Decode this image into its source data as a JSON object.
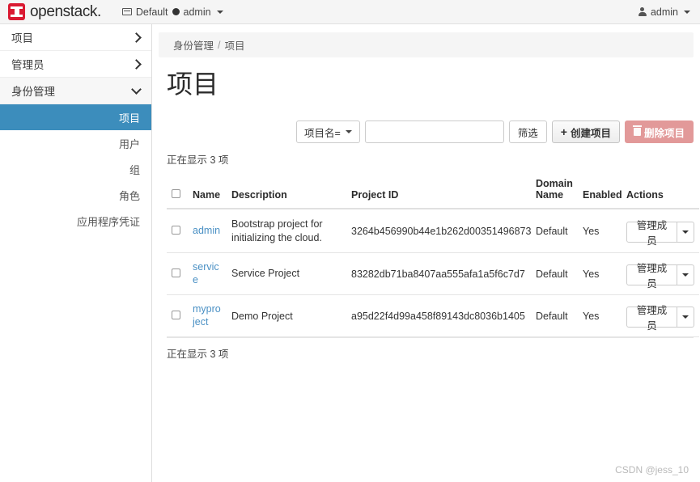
{
  "navbar": {
    "brand": "openstack.",
    "brand_logo_icon": "openstack-logo-icon",
    "domain_icon": "domain-card-icon",
    "domain_label": "Default",
    "project_dot_icon": "project-dot-icon",
    "project_label": "admin",
    "context_caret_icon": "chevron-down-icon",
    "user_icon": "user-icon",
    "user_label": "admin",
    "user_caret_icon": "chevron-down-icon"
  },
  "sidebar": {
    "groups": [
      {
        "label": "项目",
        "icon": "chevron-right-icon",
        "expanded": false
      },
      {
        "label": "管理员",
        "icon": "chevron-right-icon",
        "expanded": false
      },
      {
        "label": "身份管理",
        "icon": "chevron-down-icon",
        "expanded": true
      }
    ],
    "items": [
      {
        "label": "项目",
        "active": true
      },
      {
        "label": "用户",
        "active": false
      },
      {
        "label": "组",
        "active": false
      },
      {
        "label": "角色",
        "active": false
      },
      {
        "label": "应用程序凭证",
        "active": false
      }
    ]
  },
  "breadcrumb": {
    "parent": "身份管理",
    "separator": "/",
    "current": "项目"
  },
  "page": {
    "title": "项目"
  },
  "toolbar": {
    "filter_key_label": "项目名=",
    "filter_key_caret_icon": "chevron-down-icon",
    "search_value": "",
    "search_placeholder": "",
    "filter_button_label": "筛选",
    "create_button_label": "创建项目",
    "create_button_icon": "plus-icon",
    "delete_button_label": "删除项目",
    "delete_button_icon": "trash-icon"
  },
  "table": {
    "count_top": "正在显示 3 项",
    "count_bottom": "正在显示 3 项",
    "select_all_icon": "checkbox-icon",
    "columns": [
      "Name",
      "Description",
      "Project ID",
      "Domain Name",
      "Enabled",
      "Actions"
    ],
    "rows": [
      {
        "checkbox_icon": "checkbox-icon",
        "name": "admin",
        "description": "Bootstrap project for initializing the cloud.",
        "project_id": "3264b456990b44e1b262d00351496873",
        "domain_name": "Default",
        "enabled": "Yes",
        "action_label": "管理成员",
        "action_caret_icon": "chevron-down-icon"
      },
      {
        "checkbox_icon": "checkbox-icon",
        "name": "service",
        "description": "Service Project",
        "project_id": "83282db71ba8407aa555afa1a5f6c7d7",
        "domain_name": "Default",
        "enabled": "Yes",
        "action_label": "管理成员",
        "action_caret_icon": "chevron-down-icon"
      },
      {
        "checkbox_icon": "checkbox-icon",
        "name": "myproject",
        "description": "Demo Project",
        "project_id": "a95d22f4d99a458f89143dc8036b1405",
        "domain_name": "Default",
        "enabled": "Yes",
        "action_label": "管理成员",
        "action_caret_icon": "chevron-down-icon"
      }
    ]
  },
  "watermark": "CSDN @jess_10",
  "colors": {
    "brand_red": "#da1a32",
    "active_blue": "#3c8dbc",
    "link_blue": "#4a90c4",
    "danger_muted": "#e29999",
    "panel_grey": "#f5f5f5"
  }
}
